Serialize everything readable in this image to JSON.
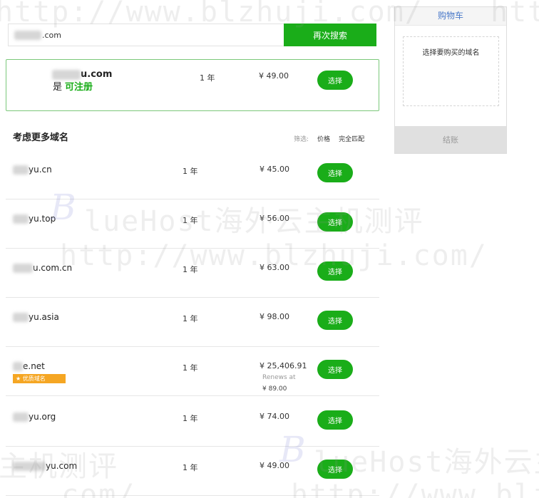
{
  "watermark": {
    "url": "http://www.blzhuji.com/",
    "text": "lueHost海外云主机测评",
    "letter": "B",
    "short_right": "htt",
    "left_text": "主机测评",
    "bottom_left": ".com/",
    "bottom_right": "http://www.blzh"
  },
  "search": {
    "value": ".com",
    "button_label": "再次搜索"
  },
  "primary": {
    "domain_suffix": "u.com",
    "status_prefix": "是",
    "status": "可注册",
    "years": "1 年",
    "price": "¥ 49.00",
    "button_label": "选择"
  },
  "more": {
    "title": "考虑更多域名",
    "filter_label": "筛选:",
    "filter_price": "价格",
    "filter_exact": "完全匹配"
  },
  "rows": [
    {
      "domain": "yu.cn",
      "years": "1 年",
      "price": "¥ 45.00",
      "button": "选择"
    },
    {
      "domain": "yu.top",
      "years": "1 年",
      "price": "¥ 56.00",
      "button": "选择"
    },
    {
      "domain": "u.com.cn",
      "years": "1 年",
      "price": "¥ 63.00",
      "button": "选择"
    },
    {
      "domain": "yu.asia",
      "years": "1 年",
      "price": "¥ 98.00",
      "button": "选择"
    },
    {
      "domain": "e.net",
      "years": "1 年",
      "price": "¥ 25,406.91",
      "renews_label": "Renews at",
      "renews_price": "¥ 89.00",
      "badge": "优质域名",
      "button": "选择"
    },
    {
      "domain": "yu.org",
      "years": "1 年",
      "price": "¥ 74.00",
      "button": "选择"
    },
    {
      "domain": "yu.com",
      "years": "1 年",
      "price": "¥ 49.00",
      "button": "选择"
    }
  ],
  "cart": {
    "title": "购物车",
    "empty_text": "选择要购买的域名",
    "checkout_label": "结账"
  }
}
